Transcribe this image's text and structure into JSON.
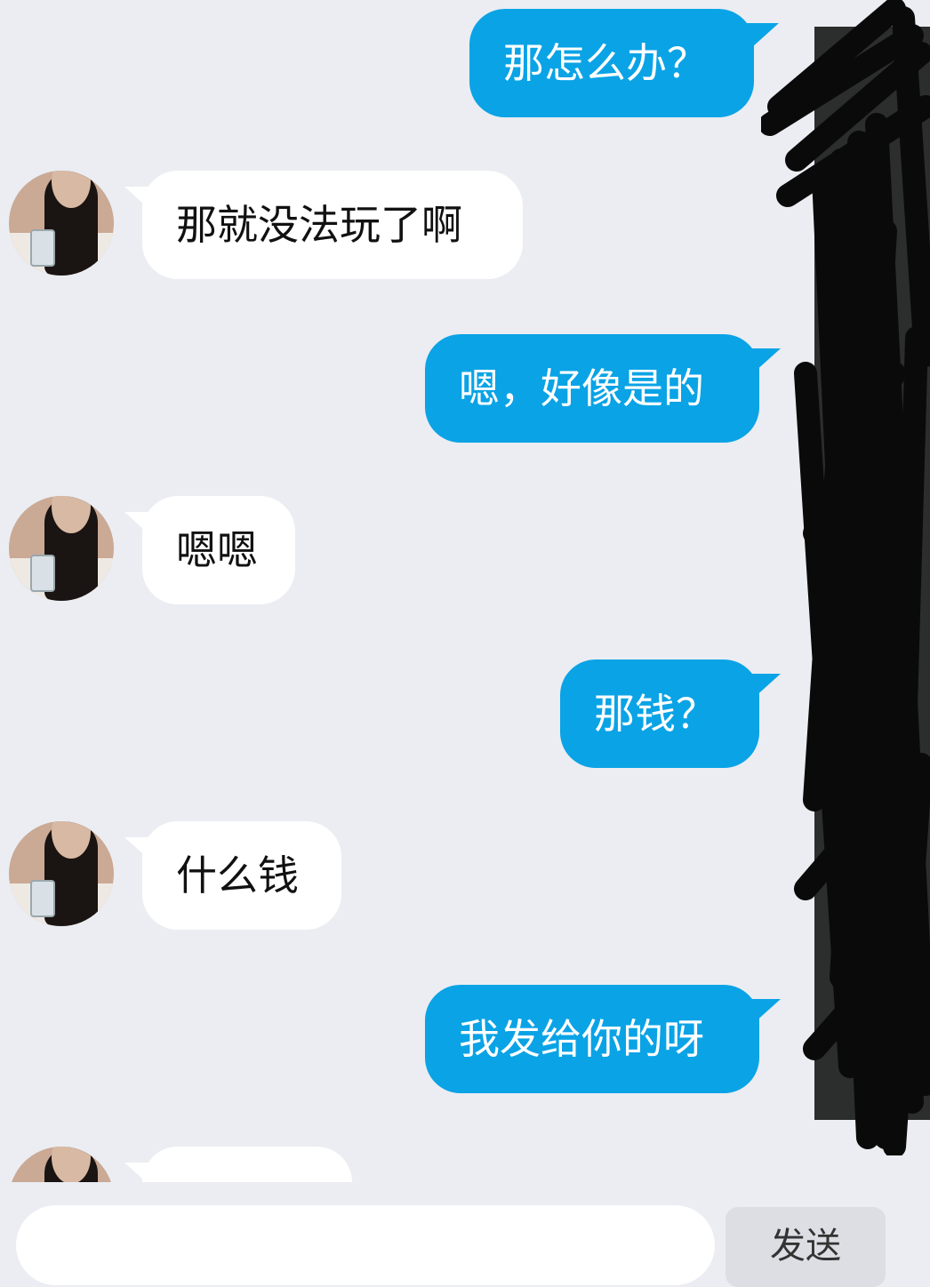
{
  "messages": [
    {
      "dir": "out",
      "text": "那怎么办？"
    },
    {
      "dir": "in",
      "text": "那就没法玩了啊"
    },
    {
      "dir": "out",
      "text": "嗯，好像是的"
    },
    {
      "dir": "in",
      "text": "嗯嗯"
    },
    {
      "dir": "out",
      "text": "那钱？"
    },
    {
      "dir": "in",
      "text": "什么钱"
    },
    {
      "dir": "out",
      "text": "我发给你的呀"
    },
    {
      "dir": "in",
      "text": "…"
    }
  ],
  "input": {
    "placeholder": ""
  },
  "send_button": {
    "label": "发送"
  },
  "colors": {
    "outgoing": "#0aa3e6",
    "incoming": "#ffffff",
    "background": "#ebedf2"
  }
}
